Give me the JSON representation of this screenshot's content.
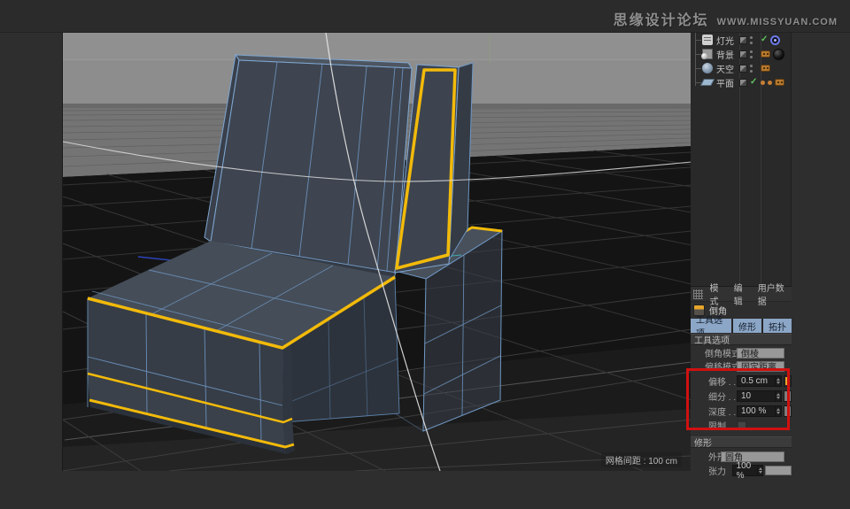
{
  "top_bar": {
    "brand_cn": "思缘设计论坛",
    "brand_url": "WWW.MISSYUAN.COM"
  },
  "viewport": {
    "grid_spacing_label": "网格间距 : 100 cm"
  },
  "object_manager": {
    "items": [
      {
        "label": "灯光"
      },
      {
        "label": "背景"
      },
      {
        "label": "天空"
      },
      {
        "label": "平面"
      }
    ]
  },
  "attributes": {
    "menu": {
      "mode": "模式",
      "edit": "编辑",
      "user_data": "用户数据"
    },
    "tool_title": "倒角",
    "tabs": {
      "tool_option": "工具选项",
      "shaping": "修形",
      "topology": "拓扑"
    },
    "section_tool": {
      "title": "工具选项",
      "bevel_mode_label": "倒角模式",
      "bevel_mode_value": "倒棱",
      "offset_mode_label": "偏移模式",
      "offset_mode_value": "固定距离",
      "offset_label": "偏移 . . .",
      "offset_value": "0.5 cm",
      "subdiv_label": "细分 . . .",
      "subdiv_value": "10",
      "depth_label": "深度 . . .",
      "depth_value": "100 %",
      "limit_label": "限制 . . ."
    },
    "section_shaping": {
      "title": "修形",
      "shape_label": "外形",
      "shape_value": "圆角",
      "tension_label": "张力",
      "tension_value": "100 %"
    }
  },
  "colors": {
    "selection_yellow": "#f2ba0a",
    "wireframe_blue": "#6f97c4",
    "highlight_red": "#d01010",
    "tab_blue": "#8ba6c6"
  }
}
